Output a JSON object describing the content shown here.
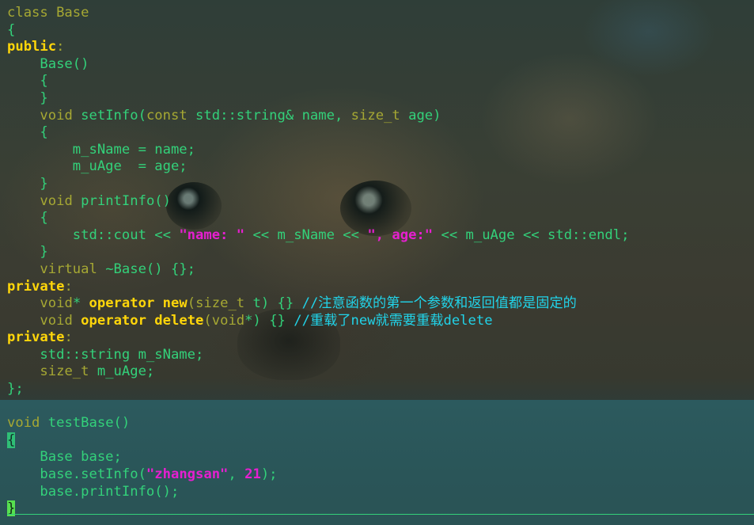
{
  "editor": {
    "lines": [
      [
        {
          "t": "class Base",
          "c": "kw"
        }
      ],
      [
        {
          "t": "{",
          "c": "txt"
        }
      ],
      [
        {
          "t": "public",
          "c": "ctl"
        },
        {
          "t": ":",
          "c": "pun"
        }
      ],
      [
        {
          "t": "    Base()",
          "c": "txt"
        }
      ],
      [
        {
          "t": "    {",
          "c": "txt"
        }
      ],
      [
        {
          "t": "    }",
          "c": "txt"
        }
      ],
      [
        {
          "t": "    ",
          "c": "txt"
        },
        {
          "t": "void",
          "c": "ty"
        },
        {
          "t": " setInfo(",
          "c": "txt"
        },
        {
          "t": "const",
          "c": "ty"
        },
        {
          "t": " std::string& name, ",
          "c": "txt"
        },
        {
          "t": "size_t",
          "c": "ty"
        },
        {
          "t": " age)",
          "c": "txt"
        }
      ],
      [
        {
          "t": "    {",
          "c": "txt"
        }
      ],
      [
        {
          "t": "        m_sName = name;",
          "c": "txt"
        }
      ],
      [
        {
          "t": "        m_uAge  = age;",
          "c": "txt"
        }
      ],
      [
        {
          "t": "    }",
          "c": "txt"
        }
      ],
      [
        {
          "t": "    ",
          "c": "txt"
        },
        {
          "t": "void",
          "c": "ty"
        },
        {
          "t": " printInfo()",
          "c": "txt"
        }
      ],
      [
        {
          "t": "    {",
          "c": "txt"
        }
      ],
      [
        {
          "t": "        std::cout << ",
          "c": "txt"
        },
        {
          "t": "\"name: \"",
          "c": "str"
        },
        {
          "t": " << m_sName << ",
          "c": "txt"
        },
        {
          "t": "\", age:\"",
          "c": "str"
        },
        {
          "t": " << m_uAge << std::endl;",
          "c": "txt"
        }
      ],
      [
        {
          "t": "    }",
          "c": "txt"
        }
      ],
      [
        {
          "t": "    ",
          "c": "txt"
        },
        {
          "t": "virtual",
          "c": "ty"
        },
        {
          "t": " ~Base() {};",
          "c": "txt"
        }
      ],
      [
        {
          "t": "private",
          "c": "ctl"
        },
        {
          "t": ":",
          "c": "pun"
        }
      ],
      [
        {
          "t": "    ",
          "c": "txt"
        },
        {
          "t": "void",
          "c": "ty"
        },
        {
          "t": "* ",
          "c": "txt"
        },
        {
          "t": "operator new",
          "c": "op"
        },
        {
          "t": "(",
          "c": "pun"
        },
        {
          "t": "size_t",
          "c": "ty"
        },
        {
          "t": " t) {} ",
          "c": "txt"
        },
        {
          "t": "//注意函数的第一个参数和返回值都是固定的",
          "c": "cmt"
        }
      ],
      [
        {
          "t": "    ",
          "c": "txt"
        },
        {
          "t": "void",
          "c": "ty"
        },
        {
          "t": " ",
          "c": "txt"
        },
        {
          "t": "operator delete",
          "c": "op"
        },
        {
          "t": "(",
          "c": "pun"
        },
        {
          "t": "void",
          "c": "ty"
        },
        {
          "t": "*) {} ",
          "c": "txt"
        },
        {
          "t": "//重载了new就需要重载delete",
          "c": "cmt"
        }
      ],
      [
        {
          "t": "private",
          "c": "ctl"
        },
        {
          "t": ":",
          "c": "pun"
        }
      ],
      [
        {
          "t": "    std::string m_sName;",
          "c": "txt"
        }
      ],
      [
        {
          "t": "    ",
          "c": "txt"
        },
        {
          "t": "size_t",
          "c": "ty"
        },
        {
          "t": " m_uAge;",
          "c": "txt"
        }
      ],
      [
        {
          "t": "};",
          "c": "txt"
        }
      ],
      [
        {
          "t": "",
          "c": "txt"
        }
      ],
      [
        {
          "t": "void",
          "c": "ty"
        },
        {
          "t": " testBase()",
          "c": "txt"
        }
      ],
      [
        {
          "t": "{",
          "c": "cursor-brace"
        }
      ],
      [
        {
          "t": "    Base base;",
          "c": "txt"
        }
      ],
      [
        {
          "t": "    base.setInfo(",
          "c": "txt"
        },
        {
          "t": "\"zhangsan\"",
          "c": "str"
        },
        {
          "t": ", ",
          "c": "txt"
        },
        {
          "t": "21",
          "c": "num"
        },
        {
          "t": ");",
          "c": "txt"
        }
      ],
      [
        {
          "t": "    base.printInfo();",
          "c": "txt"
        }
      ],
      [
        {
          "t": "}",
          "c": "cursor-brace-end"
        }
      ]
    ]
  },
  "colors": {
    "keyword": "#a6a833",
    "access_specifier": "#ffd60a",
    "string": "#e61fd0",
    "comment": "#21d3e9",
    "identifier": "#33d17a"
  }
}
